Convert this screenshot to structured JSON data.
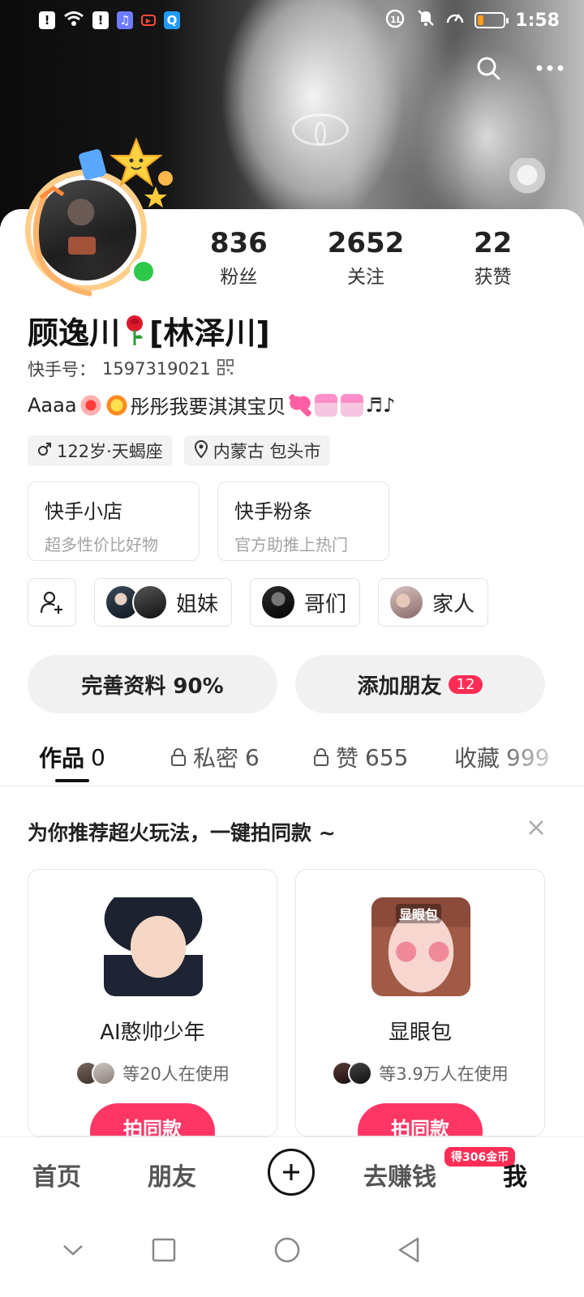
{
  "status_bar": {
    "time": "1:58",
    "network_badge": "1L",
    "left_icons": [
      "alert-icon",
      "wifi-icon",
      "alert-icon",
      "music-app-icon",
      "video-app-icon",
      "search-app-icon"
    ],
    "right_icons": [
      "network-icon",
      "mute-bell-icon",
      "speed-icon",
      "battery-icon"
    ]
  },
  "header_actions": [
    "search-icon",
    "more-icon"
  ],
  "profile": {
    "stats": [
      {
        "value": "836",
        "label": "粉丝"
      },
      {
        "value": "2652",
        "label": "关注"
      },
      {
        "value": "22",
        "label": "获赞"
      }
    ],
    "name_part1": "顾逸川",
    "name_part2": "[林泽川]",
    "id_label": "快手号：",
    "id_value": "1597319021",
    "bio_text1": "Aaaa",
    "bio_text2": "彤彤我要淇淇宝贝",
    "bio_notes": "♬♪",
    "tags": [
      {
        "icon": "male-icon",
        "text": "122岁·天蝎座"
      },
      {
        "icon": "location-icon",
        "text": "内蒙古 包头市"
      }
    ]
  },
  "shop_cards": [
    {
      "title": "快手小店",
      "subtitle": "超多性价比好物"
    },
    {
      "title": "快手粉条",
      "subtitle": "官方助推上热门"
    }
  ],
  "groups": [
    {
      "label": "姐妹"
    },
    {
      "label": "哥们"
    },
    {
      "label": "家人"
    }
  ],
  "actions": {
    "complete_profile": "完善资料 90%",
    "add_friends": "添加朋友",
    "add_friends_badge": "12"
  },
  "tabs": [
    {
      "label": "作品",
      "count": "0",
      "locked": false
    },
    {
      "label": "私密",
      "count": "6",
      "locked": true
    },
    {
      "label": "赞",
      "count": "655",
      "locked": true
    },
    {
      "label": "收藏",
      "count": "999",
      "locked": false
    }
  ],
  "recommend": {
    "title": "为你推荐超火玩法，一键拍同款 ~",
    "cards": [
      {
        "name": "AI憨帅少年",
        "users": "等20人在使用",
        "button": "拍同款"
      },
      {
        "name": "显眼包",
        "thumb_label": "显眼包",
        "users": "等3.9万人在使用",
        "button": "拍同款"
      }
    ]
  },
  "bottom_nav": {
    "items": [
      "首页",
      "朋友",
      "去赚钱",
      "我"
    ],
    "coin_badge": "得306金币",
    "active": "我"
  },
  "colors": {
    "accent": "#fe3666",
    "badge_red": "#ff2d55",
    "online_green": "#2ec84a"
  }
}
